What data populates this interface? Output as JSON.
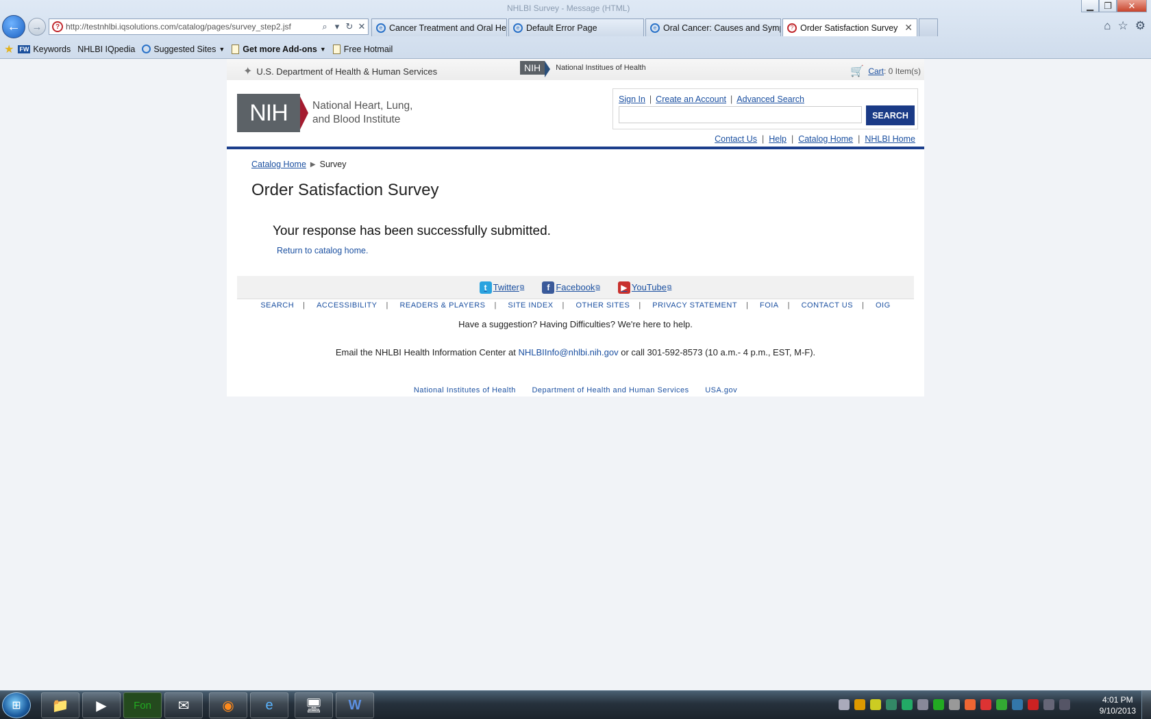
{
  "browser": {
    "window_title_faint": "NHLBI Survey - Message (HTML)",
    "address_url": "http://testnhlbi.iqsolutions.com/catalog/pages/survey_step2.jsf",
    "tabs": [
      {
        "label": "Cancer Treatment and Oral He..."
      },
      {
        "label": "Default Error Page"
      },
      {
        "label": "Oral Cancer: Causes and Symp..."
      },
      {
        "label": "Order Satisfaction Survey"
      }
    ],
    "favorites": {
      "keywords": "Keywords",
      "iqpedia": "NHLBI IQpedia",
      "suggested": "Suggested Sites",
      "addons": "Get more Add-ons",
      "hotmail": "Free Hotmail"
    }
  },
  "site": {
    "hhs": "U.S. Department of Health & Human Services",
    "nih_short": "NIH",
    "nih_full": "National Institues of Health",
    "cart_label": "Cart",
    "cart_count": ": 0 Item(s)",
    "logo_line1": "National Heart, Lung,",
    "logo_line2": "and Blood Institute",
    "search": {
      "sign_in": "Sign In",
      "create_account": "Create an Account",
      "advanced": "Advanced Search",
      "button": "SEARCH",
      "value": ""
    },
    "utility": {
      "contact": "Contact Us",
      "help": "Help",
      "catalog_home": "Catalog Home",
      "nhlbi_home": "NHLBI Home"
    }
  },
  "main": {
    "breadcrumb_home": "Catalog Home",
    "breadcrumb_current": "Survey",
    "title": "Order Satisfaction Survey",
    "success_msg": "Your response has been successfully submitted.",
    "return_link": "Return to catalog home."
  },
  "footer": {
    "social": {
      "twitter": "Twitter",
      "facebook": "Facebook",
      "youtube": "YouTube"
    },
    "nav": [
      "SEARCH",
      "ACCESSIBILITY",
      "READERS & PLAYERS",
      "SITE INDEX",
      "OTHER SITES",
      "PRIVACY STATEMENT",
      "FOIA",
      "CONTACT US",
      "OIG"
    ],
    "help_line": "Have a suggestion? Having Difficulties? We're here to help.",
    "email_prefix": "Email the NHLBI Health Information Center at ",
    "email": "NHLBIInfo@nhlbi.nih.gov",
    "email_suffix": " or call 301-592-8573 (10 a.m.- 4 p.m., EST, M-F).",
    "bottom": [
      "National Institutes of Health",
      "Department of Health and Human Services",
      "USA.gov"
    ]
  },
  "taskbar": {
    "time": "4:01 PM",
    "date": "9/10/2013"
  },
  "colors": {
    "nhlbi_blue": "#1b3e8c",
    "link_blue": "#1a4fa0",
    "nih_red": "#a51c30"
  }
}
